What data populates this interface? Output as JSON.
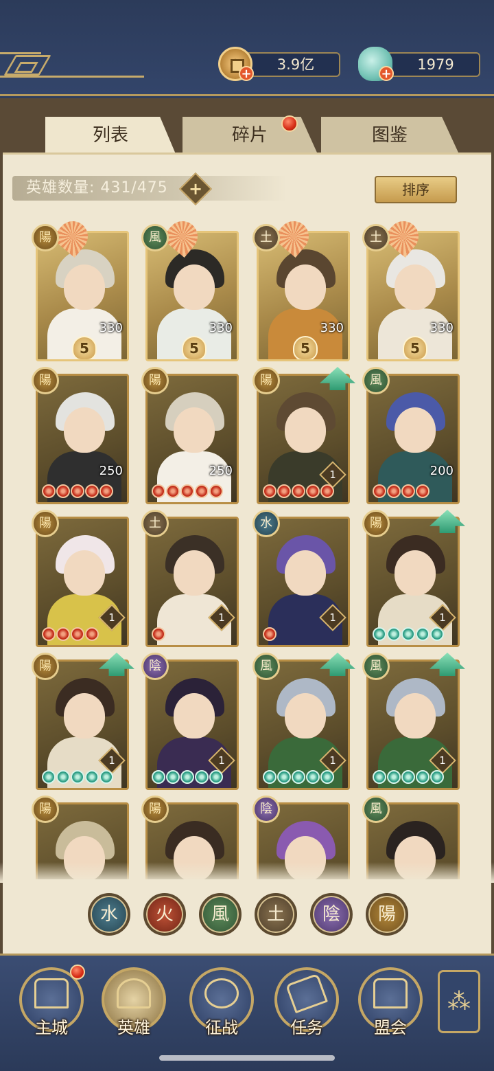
{
  "currency": {
    "coins": "3.9亿",
    "jade": "1979",
    "add_symbol": "+"
  },
  "tabs": [
    {
      "label": "列表",
      "active": true
    },
    {
      "label": "碎片",
      "active": false,
      "notification": true
    },
    {
      "label": "图鉴",
      "active": false
    }
  ],
  "hero_count": {
    "text": "英雄数量: 431/475",
    "add_symbol": "+"
  },
  "sort_label": "排序",
  "element_glyphs": {
    "yang": "陽",
    "wind": "風",
    "earth": "土",
    "water": "水",
    "yin": "陰",
    "fire": "火"
  },
  "heroes": [
    {
      "element": "陽",
      "level": "330",
      "stars": "5",
      "gold": true
    },
    {
      "element": "風",
      "level": "330",
      "stars": "5",
      "gold": true
    },
    {
      "element": "土",
      "level": "330",
      "stars": "5",
      "gold": true
    },
    {
      "element": "土",
      "level": "330",
      "stars": "5",
      "gold": true
    },
    {
      "element": "陽",
      "level": "250",
      "gems": 5,
      "gem_color": "red"
    },
    {
      "element": "陽",
      "level": "250",
      "gems": 5,
      "gem_color": "red"
    },
    {
      "element": "陽",
      "rank": "1",
      "gems": 5,
      "gem_color": "red",
      "upgrade": true
    },
    {
      "element": "風",
      "level": "200",
      "gems": 4,
      "gem_color": "red"
    },
    {
      "element": "陽",
      "rank": "1",
      "gems": 4,
      "gem_color": "red"
    },
    {
      "element": "土",
      "rank": "1",
      "gems": 1,
      "gem_color": "red"
    },
    {
      "element": "水",
      "rank": "1",
      "gems": 1,
      "gem_color": "red"
    },
    {
      "element": "陽",
      "rank": "1",
      "gems": 5,
      "gem_color": "teal",
      "upgrade": true
    },
    {
      "element": "陽",
      "rank": "1",
      "gems": 5,
      "gem_color": "teal",
      "upgrade": true
    },
    {
      "element": "陰",
      "rank": "1",
      "gems": 5,
      "gem_color": "teal"
    },
    {
      "element": "風",
      "rank": "1",
      "gems": 5,
      "gem_color": "teal",
      "upgrade": true
    },
    {
      "element": "風",
      "rank": "1",
      "gems": 5,
      "gem_color": "teal",
      "upgrade": true
    },
    {
      "element": "陽"
    },
    {
      "element": "陽"
    },
    {
      "element": "陰"
    },
    {
      "element": "風"
    }
  ],
  "filters": [
    "水",
    "火",
    "風",
    "土",
    "陰",
    "陽"
  ],
  "nav": [
    {
      "label": "主城",
      "notification": true
    },
    {
      "label": "英雄",
      "active": true
    },
    {
      "label": "征战"
    },
    {
      "label": "任务"
    },
    {
      "label": "盟会"
    }
  ],
  "more_icon": "⁂"
}
